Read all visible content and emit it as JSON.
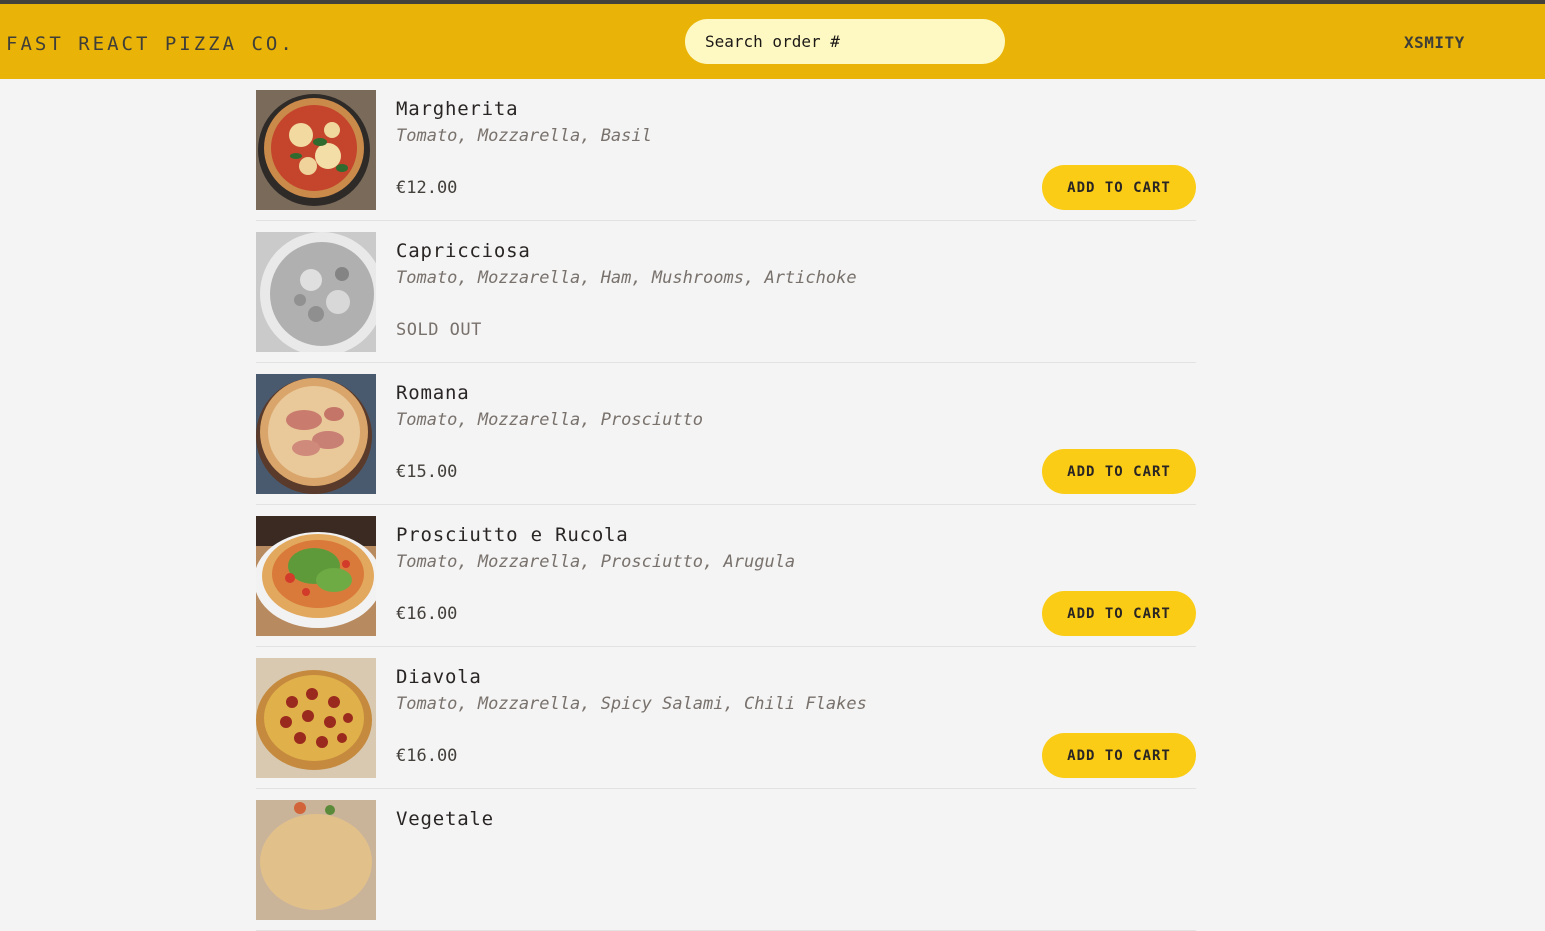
{
  "header": {
    "logo": "FAST REACT PIZZA CO.",
    "search_placeholder": "Search order #",
    "username": "XSMITY"
  },
  "menu": {
    "items": [
      {
        "name": "Margherita",
        "ingredients": "Tomato, Mozzarella, Basil",
        "price": "€12.00",
        "sold_out": false,
        "button": "ADD TO CART"
      },
      {
        "name": "Capricciosa",
        "ingredients": "Tomato, Mozzarella, Ham, Mushrooms, Artichoke",
        "status": "SOLD OUT",
        "sold_out": true
      },
      {
        "name": "Romana",
        "ingredients": "Tomato, Mozzarella, Prosciutto",
        "price": "€15.00",
        "sold_out": false,
        "button": "ADD TO CART"
      },
      {
        "name": "Prosciutto e Rucola",
        "ingredients": "Tomato, Mozzarella, Prosciutto, Arugula",
        "price": "€16.00",
        "sold_out": false,
        "button": "ADD TO CART"
      },
      {
        "name": "Diavola",
        "ingredients": "Tomato, Mozzarella, Spicy Salami, Chili Flakes",
        "price": "€16.00",
        "sold_out": false,
        "button": "ADD TO CART"
      },
      {
        "name": "Vegetale"
      }
    ]
  },
  "colors": {
    "header_bg": "#eab308",
    "button_bg": "#facc15",
    "search_bg": "#fef9c3",
    "page_bg": "#f4f4f4"
  }
}
